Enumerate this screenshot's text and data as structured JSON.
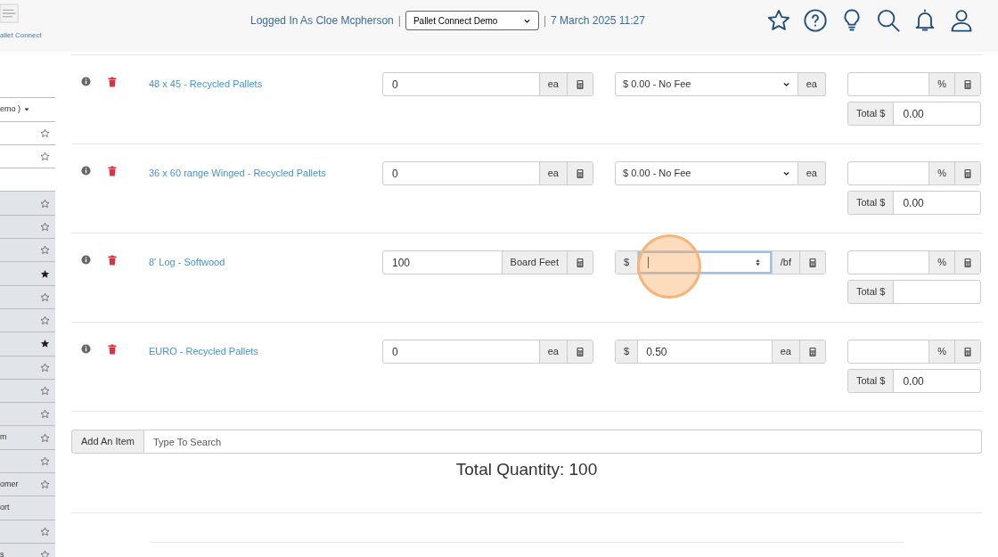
{
  "header": {
    "logo_caption": "allet Connect",
    "logged_in": "Logged In As Cloe Mcpherson",
    "separator_left": "|",
    "account_select": "Pallet Connect Demo",
    "separator_right": "|",
    "datetime": "7 March 2025 11:27"
  },
  "sidebar": {
    "items": [
      {
        "shaded": false
      },
      {
        "label": "emo )",
        "shaded": false,
        "dropdown": true
      },
      {
        "starred": false,
        "shaded": false
      },
      {
        "starred": false,
        "shaded": false
      },
      {
        "shaded": false
      },
      {
        "starred": false,
        "shaded": true
      },
      {
        "starred": false,
        "shaded": true
      },
      {
        "starred": false,
        "shaded": true
      },
      {
        "starred": true,
        "shaded": true
      },
      {
        "starred": false,
        "shaded": true
      },
      {
        "starred": false,
        "shaded": true
      },
      {
        "starred": true,
        "shaded": true
      },
      {
        "starred": false,
        "shaded": true
      },
      {
        "starred": false,
        "shaded": true
      },
      {
        "starred": false,
        "shaded": true
      },
      {
        "label": "m",
        "starred": false,
        "shaded": true
      },
      {
        "starred": false,
        "shaded": true
      },
      {
        "label": "omer",
        "starred": false,
        "shaded": true
      },
      {
        "label": "ort",
        "shaded": true
      },
      {
        "starred": false,
        "shaded": true
      },
      {
        "label": "s",
        "starred": false,
        "shaded": true
      }
    ]
  },
  "items": [
    {
      "name": "48 x 45 - Recycled Pallets",
      "quantity": "0",
      "quantity_unit": "ea",
      "price": {
        "kind": "select",
        "value": "$ 0.00 - No Fee",
        "unit": "ea"
      },
      "focused": false,
      "discount_unit": "%",
      "total_label": "Total $",
      "total": "0.00"
    },
    {
      "name": "36 x 60 range Winged - Recycled Pallets",
      "quantity": "0",
      "quantity_unit": "ea",
      "price": {
        "kind": "select",
        "value": "$ 0.00 - No Fee",
        "unit": "ea"
      },
      "focused": false,
      "discount_unit": "%",
      "total_label": "Total $",
      "total": "0.00"
    },
    {
      "name": "8' Log - Softwood",
      "quantity": "100",
      "quantity_unit": "Board Feet",
      "price": {
        "kind": "number",
        "prefix": "$",
        "unit": "/bf",
        "calculator": true
      },
      "focused": true,
      "discount_unit": "%",
      "total_label": "Total $"
    },
    {
      "name": "EURO - Recycled Pallets",
      "quantity": "0",
      "quantity_unit": "ea",
      "price": {
        "kind": "text",
        "prefix": "$",
        "value": "0.50",
        "unit": "ea",
        "calculator": true
      },
      "focused": false,
      "discount_unit": "%",
      "total_label": "Total $",
      "total": "0.00"
    }
  ],
  "add_item": {
    "button": "Add An Item",
    "placeholder": "Type To Search"
  },
  "total_quantity": "Total Quantity: 100"
}
